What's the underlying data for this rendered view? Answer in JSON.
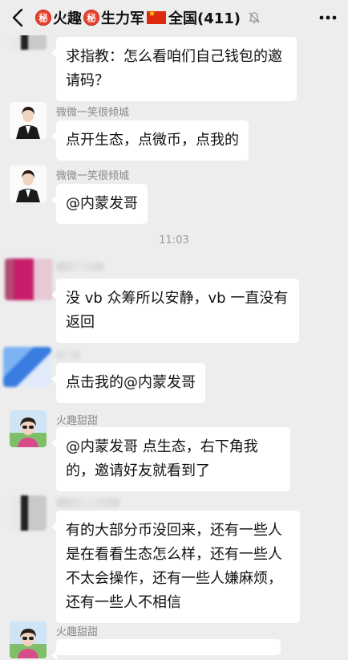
{
  "header": {
    "seal_char": "秘",
    "group_name_part1": "火趣",
    "group_name_part2": "生力军",
    "group_name_part3": "全国(411)"
  },
  "messages": [
    {
      "text": "求指教：怎么看咱们自己钱包的邀请码？"
    },
    {
      "nickname": "微微一笑很倾城",
      "text": "点开生态，点微币，点我的"
    },
    {
      "nickname": "微微一笑很倾城",
      "text": "@内蒙发哥"
    },
    {
      "timestamp": "11:03"
    },
    {
      "text": "没 vb 众筹所以安静，vb 一直没有返回"
    },
    {
      "text": "点击我的@内蒙发哥"
    },
    {
      "nickname": "火趣甜甜",
      "text": "@内蒙发哥  点生态，右下角我的，邀请好友就看到了"
    },
    {
      "text": "有的大部分币没回来，还有一些人是在看看生态怎么样，还有一些人不太会操作，还有一些人嫌麻烦，还有一些人不相信"
    },
    {
      "nickname": "火趣甜甜"
    }
  ]
}
